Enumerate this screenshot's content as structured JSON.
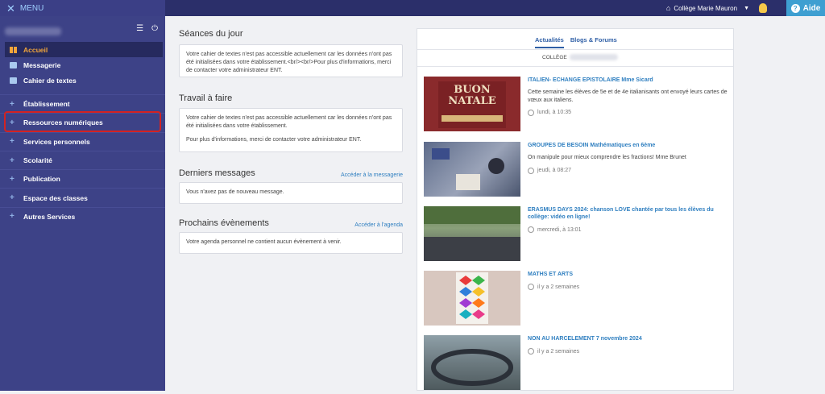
{
  "topbar": {
    "menu_label": "MENU",
    "school_name": "Collège Marie Mauron",
    "help_label": "Aide",
    "help_icon": "?"
  },
  "sidebar": {
    "main_items": [
      {
        "label": "Accueil",
        "icon": "grid-icon",
        "active": true
      },
      {
        "label": "Messagerie",
        "icon": "mail-icon"
      },
      {
        "label": "Cahier de textes",
        "icon": "book-icon"
      }
    ],
    "sections": [
      {
        "label": "Établissement"
      },
      {
        "label": "Ressources numériques"
      },
      {
        "label": "Services personnels"
      },
      {
        "label": "Scolarité"
      },
      {
        "label": "Publication"
      },
      {
        "label": "Espace des classes"
      },
      {
        "label": "Autres Services"
      }
    ],
    "highlight_color": "#d32222"
  },
  "middle": {
    "seances": {
      "title": "Séances du jour",
      "text": "Votre cahier de textes n'est pas accessible actuellement car les données n'ont pas été initialisées dans votre établissement.<br/><br/>Pour plus d'informations, merci de contacter votre administrateur ENT."
    },
    "travail": {
      "title": "Travail à faire",
      "text1": "Votre cahier de textes n'est pas accessible actuellement car les données n'ont pas été initialisées dans votre établissement.",
      "text2": "Pour plus d'informations, merci de contacter votre administrateur ENT."
    },
    "messages": {
      "title": "Derniers messages",
      "link": "Accéder à la messagerie",
      "text": "Vous n'avez pas de nouveau message."
    },
    "events": {
      "title": "Prochains évènements",
      "link": "Accéder à l'agenda",
      "text": "Votre agenda personnel ne contient aucun évènement à venir."
    }
  },
  "right": {
    "tabs": [
      "Actualités",
      "Blogs & Forums"
    ],
    "college_label": "COLLÈGE",
    "news": [
      {
        "title": "ITALIEN- ECHANGE EPISTOLAIRE Mme Sicard",
        "desc": "Cette semaine les élèves de 5e et de 4e italianisants ont envoyé leurs cartes de vœux aux italiens.",
        "time": "lundi, à 10:35",
        "thumb_text": [
          "BUON",
          "NATALE"
        ]
      },
      {
        "title": "GROUPES DE BESOIN Mathématiques en 6ème",
        "desc": "On manipule pour mieux comprendre les fractions! Mme Brunet",
        "time": "jeudi, à 08:27"
      },
      {
        "title": "ERASMUS DAYS 2024: chanson LOVE chantée par tous les élèves du collège: vidéo en ligne!",
        "desc": "",
        "time": "mercredi, à 13:01"
      },
      {
        "title": "MATHS ET ARTS",
        "desc": "",
        "time": "il y a 2 semaines"
      },
      {
        "title": "NON AU HARCELEMENT 7 novembre 2024",
        "desc": "",
        "time": "il y a 2 semaines"
      }
    ]
  }
}
